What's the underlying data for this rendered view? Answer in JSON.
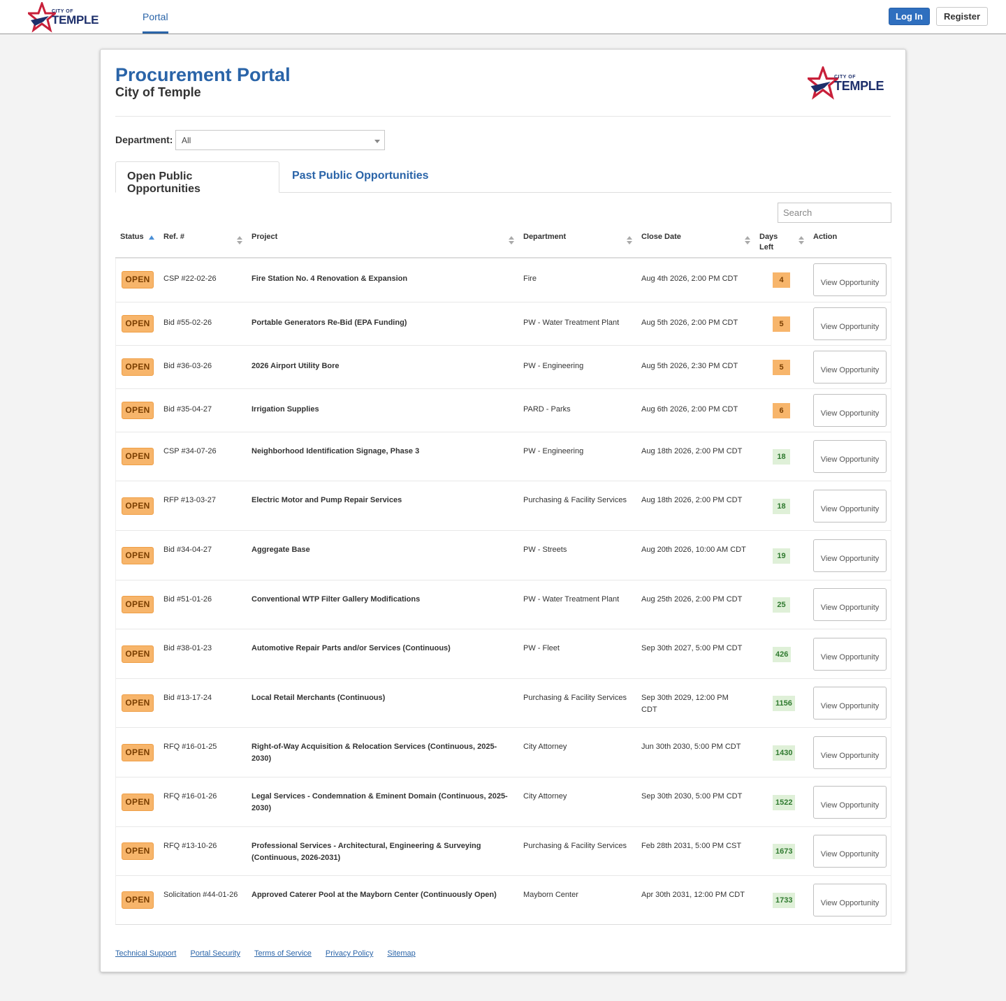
{
  "brand": {
    "logo_small": "CITY OF",
    "logo_big": "TEMPLE"
  },
  "nav": {
    "portal_tab": "Portal",
    "login_label": "Log In",
    "register_label": "Register"
  },
  "header": {
    "title": "Procurement Portal",
    "subtitle": "City of Temple"
  },
  "filter": {
    "department_label": "Department:",
    "department_value": "All"
  },
  "tabs": {
    "open": "Open Public Opportunities",
    "past": "Past Public Opportunities"
  },
  "search": {
    "placeholder": "Search"
  },
  "columns": {
    "status": "Status",
    "ref": "Ref. #",
    "project": "Project",
    "department": "Department",
    "close_date": "Close Date",
    "days_left": "Days Left",
    "action": "Action"
  },
  "colors": {
    "accent": "#2a64a8",
    "status_open": "#f7b56b",
    "days_ok": "#dff0d8"
  },
  "rows": [
    {
      "status": "OPEN",
      "ref": "CSP #22-02-26",
      "project": "Fire Station No. 4 Renovation & Expansion",
      "department": "Fire",
      "close": "Aug 4th 2026, 2:00 PM CDT",
      "days": "4",
      "action": "View Opportunity"
    },
    {
      "status": "OPEN",
      "ref": "Bid #55-02-26",
      "project": "Portable Generators Re-Bid (EPA Funding)",
      "department": "PW - Water Treatment Plant",
      "close": "Aug 5th 2026, 2:00 PM CDT",
      "days": "5",
      "action": "View Opportunity"
    },
    {
      "status": "OPEN",
      "ref": "Bid #36-03-26",
      "project": "2026 Airport Utility Bore",
      "department": "PW - Engineering",
      "close": "Aug 5th 2026, 2:30 PM CDT",
      "days": "5",
      "action": "View Opportunity"
    },
    {
      "status": "OPEN",
      "ref": "Bid #35-04-27",
      "project": "Irrigation Supplies",
      "department": "PARD - Parks",
      "close": "Aug 6th 2026, 2:00 PM CDT",
      "days": "6",
      "action": "View Opportunity"
    },
    {
      "status": "OPEN",
      "ref": "CSP #34-07-26",
      "project": "Neighborhood Identification Signage, Phase 3",
      "department": "PW - Engineering",
      "close": "Aug 18th 2026, 2:00 PM CDT",
      "days": "18",
      "action": "View Opportunity"
    },
    {
      "status": "OPEN",
      "ref": "RFP #13-03-27",
      "project": "Electric Motor and Pump Repair Services",
      "department": "Purchasing & Facility Services",
      "close": "Aug 18th 2026, 2:00 PM CDT",
      "days": "18",
      "action": "View Opportunity"
    },
    {
      "status": "OPEN",
      "ref": "Bid #34-04-27",
      "project": "Aggregate Base",
      "department": "PW - Streets",
      "close": "Aug 20th 2026, 10:00 AM CDT",
      "days": "19",
      "action": "View Opportunity"
    },
    {
      "status": "OPEN",
      "ref": "Bid #51-01-26",
      "project": "Conventional WTP Filter Gallery Modifications",
      "department": "PW - Water Treatment Plant",
      "close": "Aug 25th 2026, 2:00 PM CDT",
      "days": "25",
      "action": "View Opportunity"
    },
    {
      "status": "OPEN",
      "ref": "Bid #38-01-23",
      "project": "Automotive Repair Parts and/or Services (Continuous)",
      "department": "PW - Fleet",
      "close": "Sep 30th 2027, 5:00 PM CDT",
      "days": "426",
      "action": "View Opportunity"
    },
    {
      "status": "OPEN",
      "ref": "Bid #13-17-24",
      "project": "Local Retail Merchants (Continuous)",
      "department": "Purchasing & Facility Services",
      "close": "Sep 30th 2029, 12:00 PM CDT",
      "days": "1156",
      "action": "View Opportunity"
    },
    {
      "status": "OPEN",
      "ref": "RFQ #16-01-25",
      "project": "Right-of-Way Acquisition & Relocation Services (Continuous, 2025-2030)",
      "department": "City Attorney",
      "close": "Jun 30th 2030, 5:00 PM CDT",
      "days": "1430",
      "action": "View Opportunity"
    },
    {
      "status": "OPEN",
      "ref": "RFQ #16-01-26",
      "project": "Legal Services - Condemnation & Eminent Domain (Continuous, 2025-2030)",
      "department": "City Attorney",
      "close": "Sep 30th 2030, 5:00 PM CDT",
      "days": "1522",
      "action": "View Opportunity"
    },
    {
      "status": "OPEN",
      "ref": "RFQ #13-10-26",
      "project": "Professional Services - Architectural, Engineering & Surveying (Continuous, 2026-2031)",
      "department": "Purchasing & Facility Services",
      "close": "Feb 28th 2031, 5:00 PM CST",
      "days": "1673",
      "action": "View Opportunity"
    },
    {
      "status": "OPEN",
      "ref": "Solicitation #44-01-26",
      "project": "Approved Caterer Pool at the Mayborn Center (Continuously Open)",
      "department": "Mayborn Center",
      "close": "Apr 30th 2031, 12:00 PM CDT",
      "days": "1733",
      "action": "View Opportunity"
    }
  ],
  "footer": {
    "links": [
      "Technical Support",
      "Portal Security",
      "Terms of Service",
      "Privacy Policy",
      "Sitemap"
    ]
  }
}
